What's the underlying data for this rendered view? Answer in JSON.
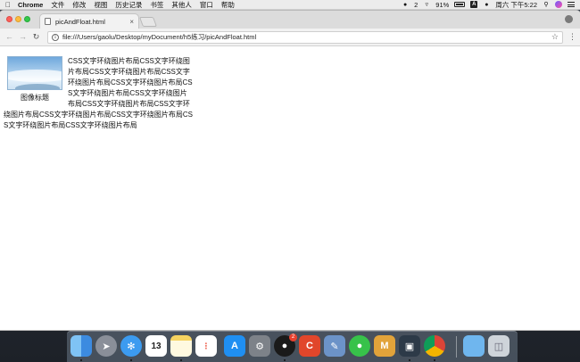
{
  "menubar": {
    "app_name": "Chrome",
    "items": [
      "文件",
      "修改",
      "视图",
      "历史记录",
      "书签",
      "其他人",
      "窗口",
      "帮助"
    ],
    "qq_count": "2",
    "battery": "91%",
    "datetime": "周六 下午5:22"
  },
  "browser": {
    "tab_title": "picAndFloat.html",
    "tab_close": "×",
    "url": "file:///Users/gaolu/Desktop/myDocument/h5练习/picAndFloat.html"
  },
  "page": {
    "caption": "图像标题",
    "body_text": "CSS文字环绕图片布局CSS文字环绕图片布局CSS文字环绕图片布局CSS文字环绕图片布局CSS文字环绕图片布局CSS文字环绕图片布局CSS文字环绕图片布局CSS文字环绕图片布局CSS文字环绕图片布局CSS文字环绕图片布局CSS文字环绕图片布局CSS文字环绕图片布局CSS文字环绕图片布局"
  },
  "dock": {
    "apps": [
      "finder",
      "launchpad",
      "safari",
      "calendar",
      "notes",
      "reminders",
      "app-store",
      "system-preferences",
      "qq",
      "codeacademy",
      "preview",
      "wechat",
      "sketch",
      "trim",
      "chrome",
      "downloads",
      "trash"
    ],
    "calendar_day": "13",
    "qq_badge": "2"
  },
  "colors": {
    "close": "#fc605b",
    "minimize": "#fdbc40",
    "maximize": "#34c84a"
  }
}
